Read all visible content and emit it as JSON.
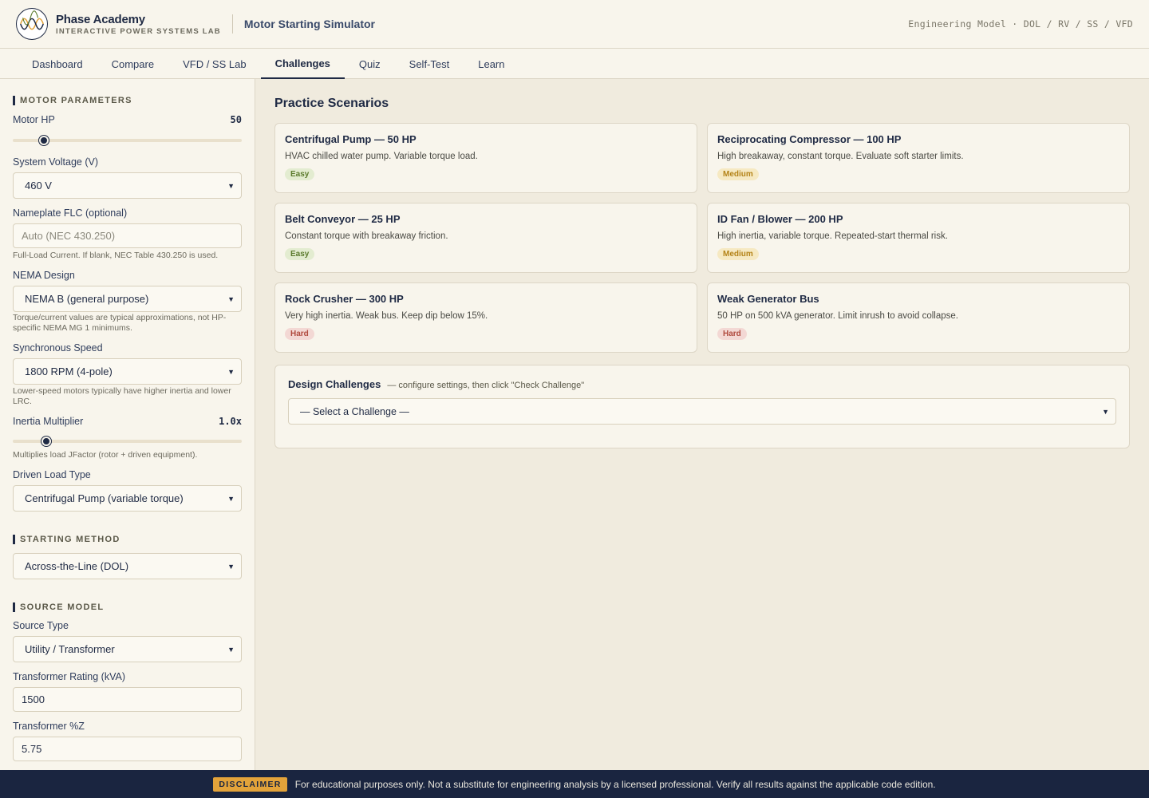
{
  "brand": {
    "name": "Phase Academy",
    "subtitle": "INTERACTIVE POWER SYSTEMS LAB",
    "app_title": "Motor Starting Simulator",
    "engine_label": "Engineering Model · DOL / RV / SS / VFD"
  },
  "tabs": [
    {
      "label": "Dashboard",
      "active": false
    },
    {
      "label": "Compare",
      "active": false
    },
    {
      "label": "VFD / SS Lab",
      "active": false
    },
    {
      "label": "Challenges",
      "active": true
    },
    {
      "label": "Quiz",
      "active": false
    },
    {
      "label": "Self-Test",
      "active": false
    },
    {
      "label": "Learn",
      "active": false
    }
  ],
  "sidebar": {
    "motor_section": "MOTOR PARAMETERS",
    "motor_hp": {
      "label": "Motor HP",
      "value": "50",
      "slider_fraction": 0.12
    },
    "voltage": {
      "label": "System Voltage (V)",
      "value": "460 V"
    },
    "flc": {
      "label": "Nameplate FLC (optional)",
      "placeholder": "Auto (NEC 430.250)",
      "hint": "Full-Load Current. If blank, NEC Table 430.250 is used."
    },
    "nema": {
      "label": "NEMA Design",
      "value": "NEMA B (general purpose)",
      "hint": "Torque/current values are typical approximations, not HP-specific NEMA MG 1 minimums."
    },
    "sync_speed": {
      "label": "Synchronous Speed",
      "value": "1800 RPM (4-pole)",
      "hint": "Lower-speed motors typically have higher inertia and lower LRC."
    },
    "inertia": {
      "label": "Inertia Multiplier",
      "value": "1.0x",
      "slider_fraction": 0.13,
      "hint": "Multiplies load JFactor (rotor + driven equipment)."
    },
    "load_type": {
      "label": "Driven Load Type",
      "value": "Centrifugal Pump (variable torque)"
    },
    "starting_section": "STARTING METHOD",
    "starting_method": {
      "value": "Across-the-Line (DOL)"
    },
    "source_section": "SOURCE MODEL",
    "source_type": {
      "label": "Source Type",
      "value": "Utility / Transformer"
    },
    "xfmr_rating": {
      "label": "Transformer Rating (kVA)",
      "value": "1500"
    },
    "xfmr_z": {
      "label": "Transformer %Z",
      "value": "5.75"
    }
  },
  "main": {
    "title": "Practice Scenarios",
    "scenarios": [
      {
        "title": "Centrifugal Pump — 50 HP",
        "desc": "HVAC chilled water pump. Variable torque load.",
        "level": "Easy"
      },
      {
        "title": "Reciprocating Compressor — 100 HP",
        "desc": "High breakaway, constant torque. Evaluate soft starter limits.",
        "level": "Medium"
      },
      {
        "title": "Belt Conveyor — 25 HP",
        "desc": "Constant torque with breakaway friction.",
        "level": "Easy"
      },
      {
        "title": "ID Fan / Blower — 200 HP",
        "desc": "High inertia, variable torque. Repeated-start thermal risk.",
        "level": "Medium"
      },
      {
        "title": "Rock Crusher — 300 HP",
        "desc": "Very high inertia. Weak bus. Keep dip below 15%.",
        "level": "Hard"
      },
      {
        "title": "Weak Generator Bus",
        "desc": "50 HP on 500 kVA generator. Limit inrush to avoid collapse.",
        "level": "Hard"
      }
    ],
    "design_challenges": {
      "title": "Design Challenges",
      "subtitle": "— configure settings, then click \"Check Challenge\"",
      "select_value": "— Select a Challenge —"
    }
  },
  "footer": {
    "badge": "DISCLAIMER",
    "text": "For educational purposes only. Not a substitute for engineering analysis by a licensed professional. Verify all results against the applicable code edition."
  },
  "colors": {
    "navy": "#1f2a44",
    "easy": "#5b7a2c",
    "medium": "#b48318",
    "hard": "#b04a3e",
    "footer_bg": "#1a2540",
    "badge_bg": "#e3a33a"
  }
}
